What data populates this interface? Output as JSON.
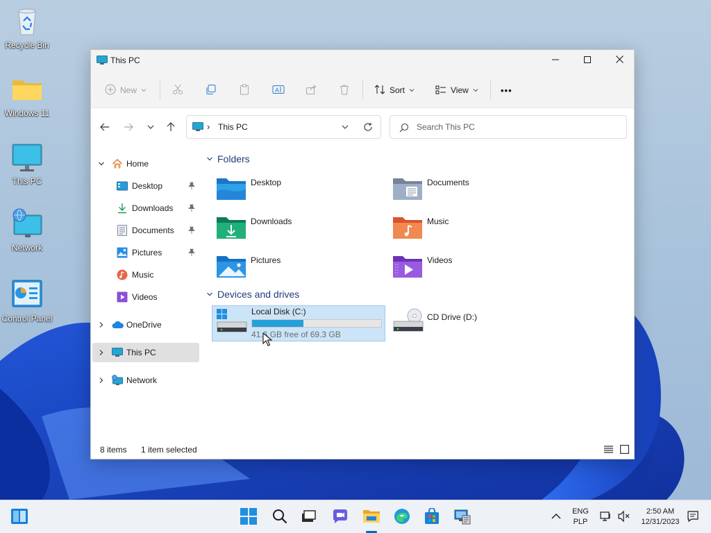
{
  "desktop": {
    "icons": [
      {
        "label": "Recycle Bin"
      },
      {
        "label": "Windows 11"
      },
      {
        "label": "This PC"
      },
      {
        "label": "Network"
      },
      {
        "label": "Control Panel"
      }
    ]
  },
  "window": {
    "title": "This PC",
    "controls": {
      "minimize": "minimize",
      "maximize": "maximize",
      "close": "close"
    }
  },
  "toolbar": {
    "new_label": "New",
    "sort_label": "Sort",
    "view_label": "View",
    "more_label": "•••"
  },
  "address": {
    "path": "This PC",
    "separator": "›"
  },
  "search": {
    "placeholder": "Search This PC"
  },
  "nav": {
    "home": "Home",
    "quick": [
      {
        "label": "Desktop",
        "pinned": true
      },
      {
        "label": "Downloads",
        "pinned": true
      },
      {
        "label": "Documents",
        "pinned": true
      },
      {
        "label": "Pictures",
        "pinned": true
      },
      {
        "label": "Music",
        "pinned": false
      },
      {
        "label": "Videos",
        "pinned": false
      }
    ],
    "onedrive": "OneDrive",
    "thispc": "This PC",
    "network": "Network"
  },
  "content": {
    "folders_header": "Folders",
    "folders": [
      {
        "label": "Desktop"
      },
      {
        "label": "Documents"
      },
      {
        "label": "Downloads"
      },
      {
        "label": "Music"
      },
      {
        "label": "Pictures"
      },
      {
        "label": "Videos"
      }
    ],
    "drives_header": "Devices and drives",
    "drives": [
      {
        "label": "Local Disk (C:)",
        "free_text": "41.6 GB free of 69.3 GB",
        "used_fraction": 0.4
      },
      {
        "label": "CD Drive (D:)"
      }
    ]
  },
  "status": {
    "items": "8 items",
    "selected": "1 item selected"
  },
  "taskbar": {
    "lang_line1": "ENG",
    "lang_line2": "PLP",
    "time": "2:50 AM",
    "date": "12/31/2023"
  },
  "colors": {
    "accent": "#0078d4",
    "drive_bar": "#26a0da",
    "selection": "#cce4f7",
    "section_header": "#1f3d7a"
  }
}
